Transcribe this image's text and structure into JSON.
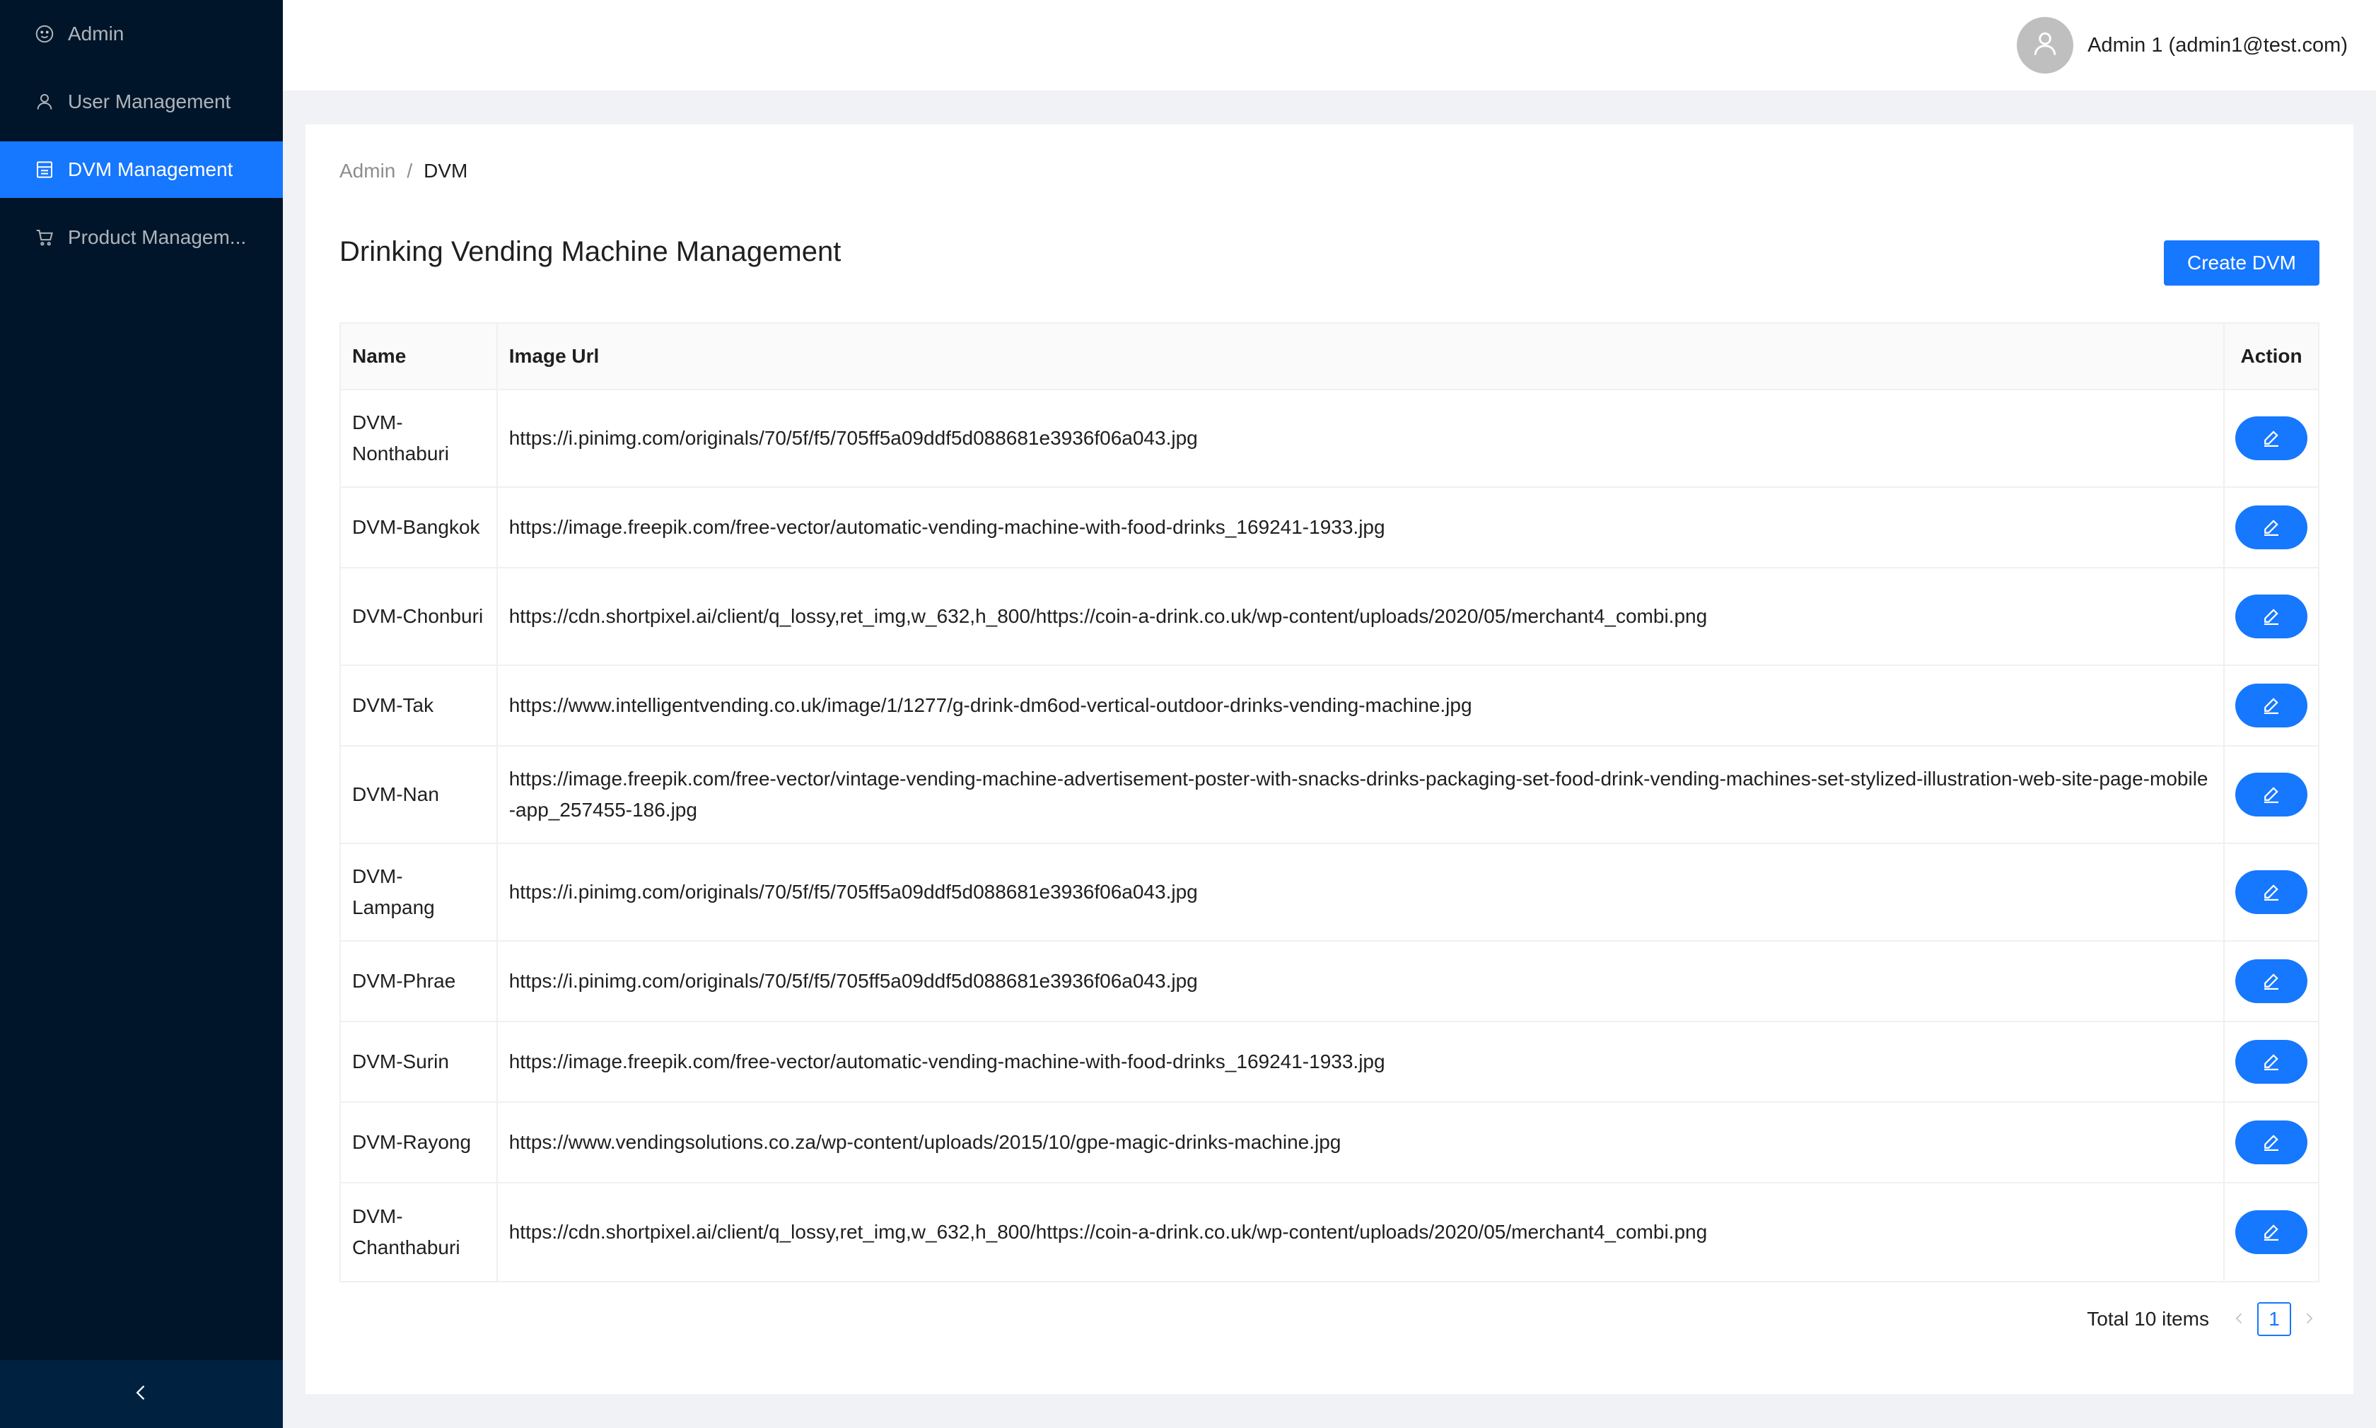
{
  "sidebar": {
    "items": [
      {
        "label": "Admin",
        "icon": "smile-icon",
        "active": false
      },
      {
        "label": "User Management",
        "icon": "user-icon",
        "active": false
      },
      {
        "label": "DVM Management",
        "icon": "shop-icon",
        "active": true
      },
      {
        "label": "Product Managem...",
        "icon": "shopping-cart-icon",
        "active": false
      }
    ],
    "collapse_icon": "chevron-left-icon"
  },
  "header": {
    "user_name": "Admin 1 (admin1@test.com)",
    "avatar_icon": "user-icon"
  },
  "breadcrumb": {
    "parent": "Admin",
    "separator": "/",
    "current": "DVM"
  },
  "page": {
    "title": "Drinking Vending Machine Management",
    "create_label": "Create DVM"
  },
  "table": {
    "headers": {
      "name": "Name",
      "image_url": "Image Url",
      "action": "Action"
    },
    "rows": [
      {
        "name": "DVM-Nonthaburi",
        "image_url": "https://i.pinimg.com/originals/70/5f/f5/705ff5a09ddf5d088681e3936f06a043.jpg"
      },
      {
        "name": "DVM-Bangkok",
        "image_url": "https://image.freepik.com/free-vector/automatic-vending-machine-with-food-drinks_169241-1933.jpg"
      },
      {
        "name": "DVM-Chonburi",
        "image_url": "https://cdn.shortpixel.ai/client/q_lossy,ret_img,w_632,h_800/https://coin-a-drink.co.uk/wp-content/uploads/2020/05/merchant4_combi.png"
      },
      {
        "name": "DVM-Tak",
        "image_url": "https://www.intelligentvending.co.uk/image/1/1277/g-drink-dm6od-vertical-outdoor-drinks-vending-machine.jpg"
      },
      {
        "name": "DVM-Nan",
        "image_url": "https://image.freepik.com/free-vector/vintage-vending-machine-advertisement-poster-with-snacks-drinks-packaging-set-food-drink-vending-machines-set-stylized-illustration-web-site-page-mobile-app_257455-186.jpg"
      },
      {
        "name": "DVM-Lampang",
        "image_url": "https://i.pinimg.com/originals/70/5f/f5/705ff5a09ddf5d088681e3936f06a043.jpg"
      },
      {
        "name": "DVM-Phrae",
        "image_url": "https://i.pinimg.com/originals/70/5f/f5/705ff5a09ddf5d088681e3936f06a043.jpg"
      },
      {
        "name": "DVM-Surin",
        "image_url": "https://image.freepik.com/free-vector/automatic-vending-machine-with-food-drinks_169241-1933.jpg"
      },
      {
        "name": "DVM-Rayong",
        "image_url": "https://www.vendingsolutions.co.za/wp-content/uploads/2015/10/gpe-magic-drinks-machine.jpg"
      },
      {
        "name": "DVM-Chanthaburi",
        "image_url": "https://cdn.shortpixel.ai/client/q_lossy,ret_img,w_632,h_800/https://coin-a-drink.co.uk/wp-content/uploads/2020/05/merchant4_combi.png"
      }
    ],
    "edit_icon": "edit-icon"
  },
  "pagination": {
    "total": "Total 10 items",
    "current_page": "1",
    "prev_icon": "chevron-left-icon",
    "next_icon": "chevron-right-icon"
  },
  "colors": {
    "sidebar_bg": "#001529",
    "primary": "#1677ff",
    "page_bg": "#f0f2f5"
  }
}
